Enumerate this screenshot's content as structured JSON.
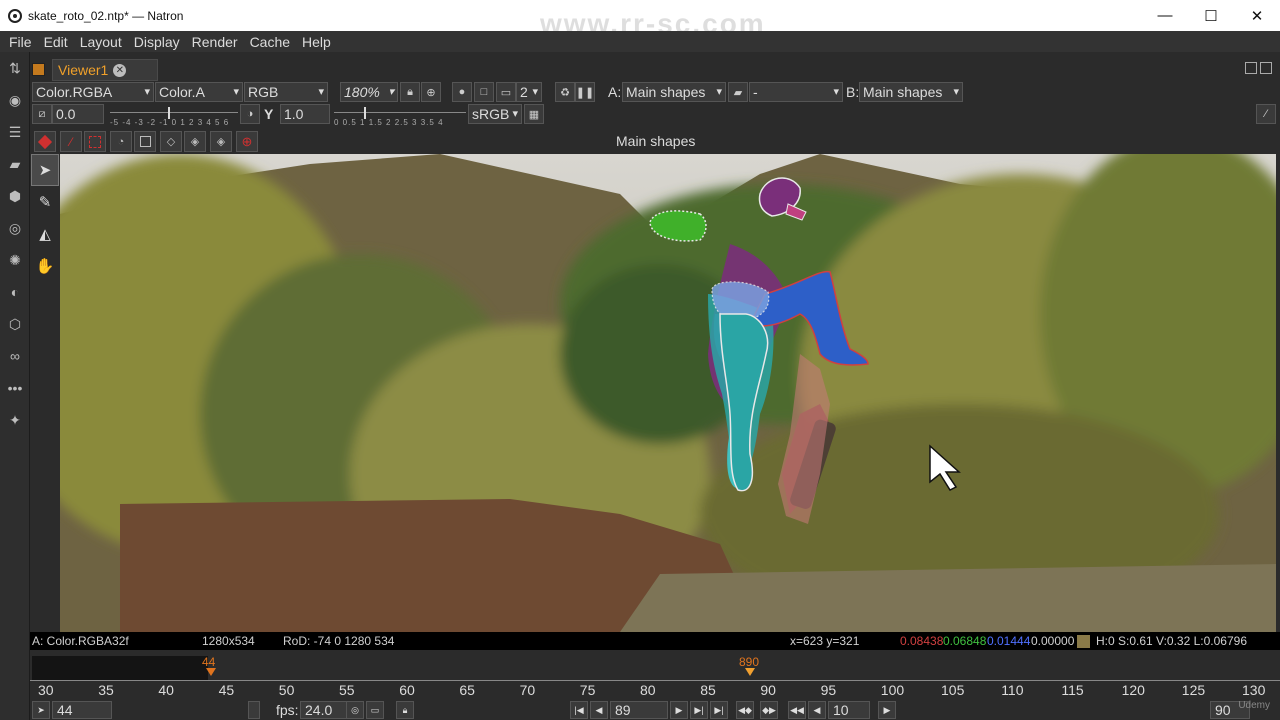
{
  "window": {
    "title": "skate_roto_02.ntp* — Natron",
    "minimize": "—",
    "maximize": "☐",
    "close": "✕"
  },
  "menu": [
    "File",
    "Edit",
    "Layout",
    "Display",
    "Render",
    "Cache",
    "Help"
  ],
  "viewer_tab": {
    "label": "Viewer1",
    "close": "✕"
  },
  "toolbar1": {
    "layer": "Color.RGBA",
    "alpha": "Color.A",
    "display": "RGB",
    "zoom": "180%",
    "proxy_level": "2",
    "a_label": "A:",
    "a_input": "Main shapes",
    "composite": "-",
    "b_label": "B:",
    "b_input": "Main shapes"
  },
  "toolbar2": {
    "gain_value": "0.0",
    "gain_ticks": "-5 -4 -3 -2 -1 0 1 2 3 4 5 6",
    "gamma_label": "Y",
    "gamma_value": "1.0",
    "gamma_ticks": "0 0.5 1 1.5 2 2.5 3 3.5 4",
    "colorspace": "sRGB"
  },
  "roto": {
    "title": "Main shapes"
  },
  "infobar": {
    "channels": "A: Color.RGBA32f",
    "format": "1280x534",
    "rod": "RoD: -74 0 1280 534",
    "coords": "x=623 y=321",
    "r": "0.08438",
    "g": "0.06848",
    "b": "0.01444",
    "a": "0.00000",
    "hsvl": "H:0 S:0.61 V:0.32 L:0.06796",
    "swatch_color": "#8a7a48"
  },
  "timeline": {
    "ticks": [
      "30",
      "35",
      "40",
      "45",
      "50",
      "55",
      "60",
      "65",
      "70",
      "75",
      "80",
      "85",
      "90",
      "95",
      "100",
      "105",
      "110",
      "115",
      "120",
      "125",
      "130"
    ],
    "in_marker": "44",
    "current_marker": "890"
  },
  "bottom": {
    "first_frame": "44",
    "fps_label": "fps:",
    "fps_value": "24.0",
    "current_frame": "89",
    "increment": "10",
    "last_frame": "90"
  },
  "watermark": "www.rr-sc.com",
  "udemy": "Udemy",
  "colors": {
    "accent": "#f1a12a",
    "r_channel": "#d04040",
    "g_channel": "#40c040",
    "b_channel": "#5070ff"
  }
}
